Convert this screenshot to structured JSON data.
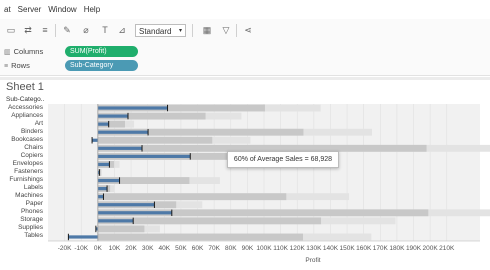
{
  "menu": [
    "at",
    "Server",
    "Window",
    "Help"
  ],
  "toolbar": {
    "fit": "Standard",
    "arrow": "▾"
  },
  "shelves": {
    "columns": {
      "label": "Columns",
      "pill": "SUM(Profit)",
      "color": "#1fae6c"
    },
    "rows": {
      "label": "Rows",
      "pill": "Sub-Category",
      "color": "#4b9ab4"
    }
  },
  "sheet": {
    "title": "Sheet 1",
    "row_header": "Sub-Catego.."
  },
  "tooltip": "60% of Average Sales = 68,928",
  "colors": {
    "bar": "#4e79a7",
    "band_dark": "#c8c8c8",
    "band_light": "#e3e3e3",
    "refline": "#1a1a1a"
  },
  "chart_data": {
    "type": "bar",
    "xlabel": "Profit",
    "xlim": [
      -30000,
      230000
    ],
    "xticks": [
      -20000,
      -10000,
      0,
      10000,
      20000,
      30000,
      40000,
      50000,
      60000,
      70000,
      80000,
      90000,
      100000,
      110000,
      120000,
      130000,
      140000,
      150000,
      160000,
      170000,
      180000,
      190000,
      200000,
      210000
    ],
    "xtick_labels": [
      "-20K",
      "-10K",
      "0K",
      "10K",
      "20K",
      "30K",
      "40K",
      "50K",
      "60K",
      "70K",
      "80K",
      "90K",
      "100K",
      "110K",
      "120K",
      "130K",
      "140K",
      "150K",
      "160K",
      "170K",
      "180K",
      "190K",
      "200K",
      "210K"
    ],
    "categories": [
      "Accessories",
      "Appliances",
      "Art",
      "Binders",
      "Bookcases",
      "Chairs",
      "Copiers",
      "Envelopes",
      "Fasteners",
      "Furnishings",
      "Labels",
      "Machines",
      "Paper",
      "Phones",
      "Storage",
      "Supplies",
      "Tables"
    ],
    "values": [
      41937,
      18138,
      6528,
      30222,
      -3473,
      26590,
      55618,
      6964,
      950,
      13059,
      5546,
      3385,
      34054,
      44516,
      21279,
      -1189,
      -17725
    ],
    "reference_line": [
      41937,
      18138,
      6528,
      30222,
      -3473,
      26590,
      55618,
      6964,
      950,
      13059,
      5546,
      3385,
      34054,
      44516,
      21279,
      -1189,
      -17725
    ],
    "band_60pct_sales": [
      100583,
      64811,
      16329,
      123742,
      68871,
      197836,
      89924,
      9809,
      1826,
      55106,
      7400,
      113413,
      47152,
      198883,
      134339,
      28040,
      123465
    ],
    "band_80pct_sales": [
      134110,
      86415,
      21772,
      164989,
      91828,
      263781,
      119898,
      13079,
      2434,
      73475,
      9867,
      151218,
      62870,
      265177,
      179119,
      37387,
      164620
    ]
  }
}
